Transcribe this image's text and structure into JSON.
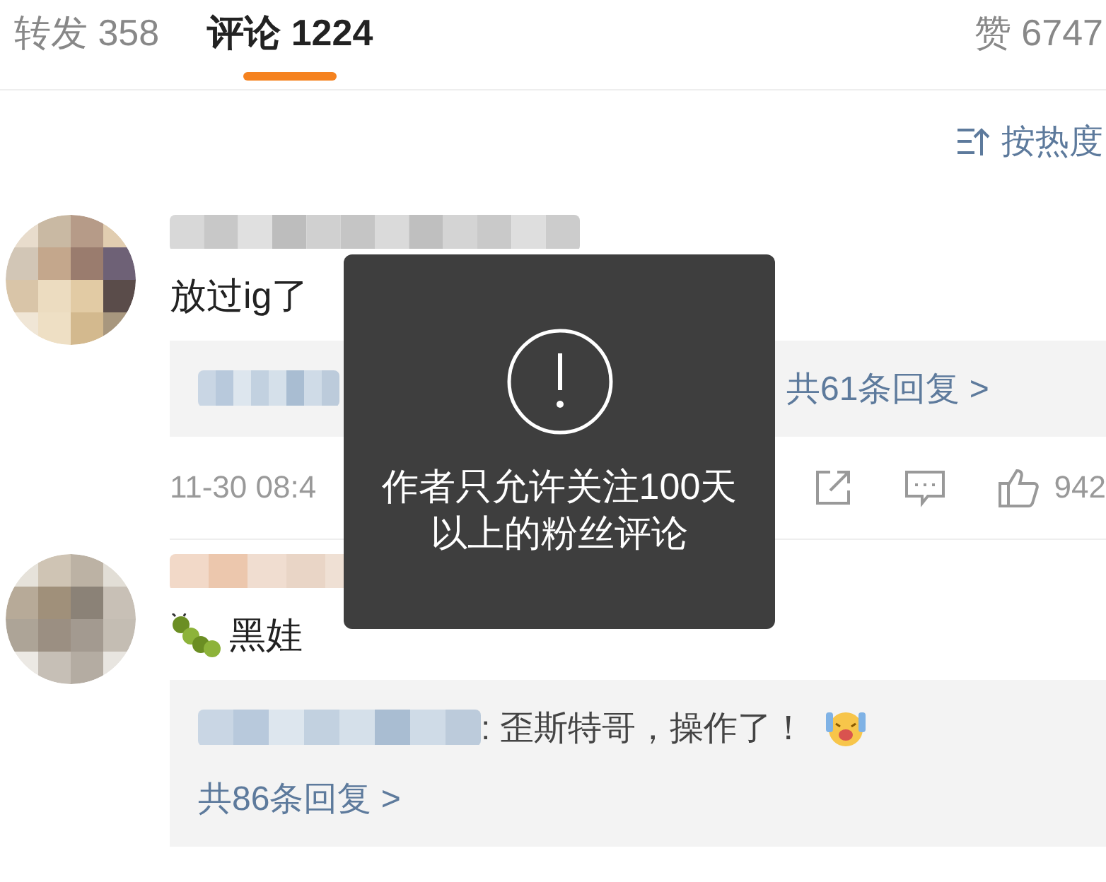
{
  "tabs": [
    {
      "label": "转发 358",
      "selected": false
    },
    {
      "label": "评论 1224",
      "selected": true
    },
    {
      "label": "赞 6747",
      "selected": false
    }
  ],
  "sort": {
    "label": "按热度"
  },
  "comments": [
    {
      "text": "放过ig了",
      "reply_count": "共61条回复 >",
      "time": "11-30 08:4",
      "likes": "942"
    },
    {
      "text": "黑娃",
      "reply_line": ": 歪斯特哥，操作了！",
      "reply_count": "共86条回复 >"
    }
  ],
  "toast": {
    "message": "作者只允许关注100天以上的粉丝评论"
  }
}
